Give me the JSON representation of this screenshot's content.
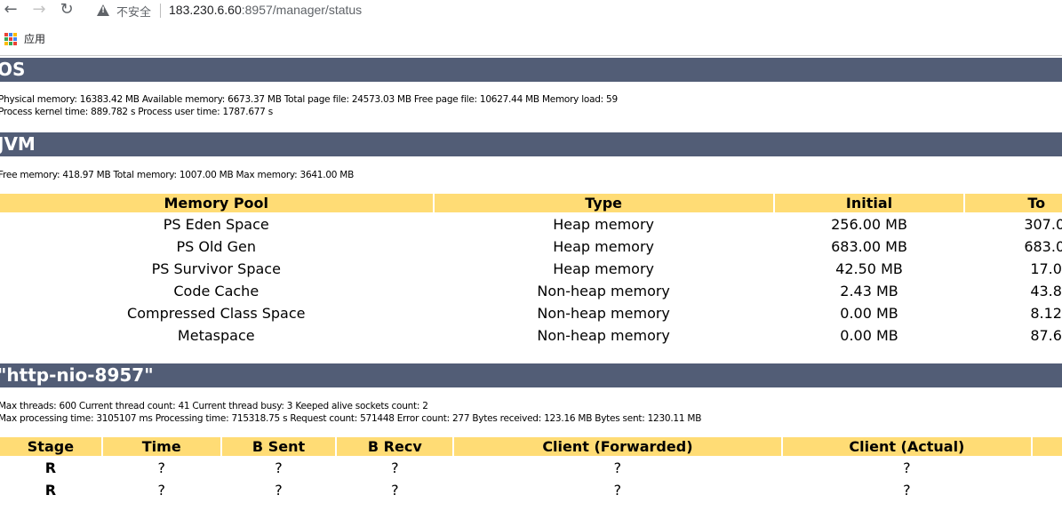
{
  "browser": {
    "back": "←",
    "forward": "→",
    "reload": "↻",
    "security_label": "不安全",
    "url_host": "183.230.6.60",
    "url_rest": ":8957/manager/status",
    "bookmark_apps": "应用"
  },
  "os": {
    "title": "OS",
    "line1": "Physical memory: 16383.42 MB Available memory: 6673.37 MB Total page file: 24573.03 MB Free page file: 10627.44 MB Memory load: 59",
    "line2": "Process kernel time: 889.782 s Process user time: 1787.677 s"
  },
  "jvm": {
    "title": "JVM",
    "memory_line": "Free memory: 418.97 MB Total memory: 1007.00 MB Max memory: 3641.00 MB",
    "headers": [
      "Memory Pool",
      "Type",
      "Initial",
      "To"
    ],
    "rows": [
      [
        "PS Eden Space",
        "Heap memory",
        "256.00 MB",
        "307.0"
      ],
      [
        "PS Old Gen",
        "Heap memory",
        "683.00 MB",
        "683.0"
      ],
      [
        "PS Survivor Space",
        "Heap memory",
        "42.50 MB",
        "17.0"
      ],
      [
        "Code Cache",
        "Non-heap memory",
        "2.43 MB",
        "43.8"
      ],
      [
        "Compressed Class Space",
        "Non-heap memory",
        "0.00 MB",
        "8.12"
      ],
      [
        "Metaspace",
        "Non-heap memory",
        "0.00 MB",
        "87.6"
      ]
    ]
  },
  "connector": {
    "title": "\"http-nio-8957\"",
    "line1": "Max threads: 600 Current thread count: 41 Current thread busy: 3 Keeped alive sockets count: 2",
    "line2": "Max processing time: 3105107 ms Processing time: 715318.75 s Request count: 571448 Error count: 277 Bytes received: 123.16 MB Bytes sent: 1230.11 MB",
    "headers": [
      "Stage",
      "Time",
      "B Sent",
      "B Recv",
      "Client (Forwarded)",
      "Client (Actual)",
      ""
    ],
    "rows": [
      [
        "R",
        "?",
        "?",
        "?",
        "?",
        "?"
      ],
      [
        "R",
        "?",
        "?",
        "?",
        "?",
        "?"
      ]
    ]
  },
  "colors": {
    "header_bar": "#525d76",
    "table_header": "#ffdc75"
  }
}
